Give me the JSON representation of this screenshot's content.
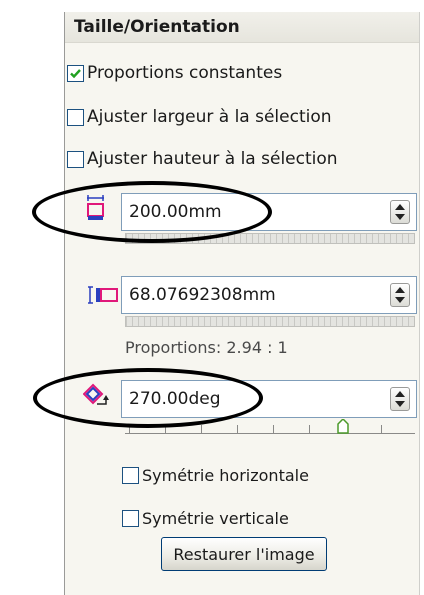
{
  "panel": {
    "title": "Taille/Orientation"
  },
  "checkboxes": [
    {
      "label": "Proportions constantes",
      "checked": true
    },
    {
      "label": "Ajuster largeur à la sélection",
      "checked": false
    },
    {
      "label": "Ajuster hauteur à la sélection",
      "checked": false
    }
  ],
  "height_field": {
    "value": "200.00mm",
    "icon": "height-icon"
  },
  "width_field": {
    "value": "68.07692308mm",
    "icon": "width-icon"
  },
  "proportions_text": "Proportions: 2.94 : 1",
  "angle_field": {
    "value": "270.00deg",
    "icon": "rotate-icon",
    "slider_level": 0.75
  },
  "symmetry": [
    {
      "label": "Symétrie horizontale",
      "checked": false
    },
    {
      "label": "Symétrie verticale",
      "checked": false
    }
  ],
  "restore_button": "Restaurer l'image",
  "colors": {
    "accent_check": "#21a121",
    "icon_magenta": "#e0187a",
    "icon_blue": "#2a3fbf",
    "annotation": "#000000"
  }
}
